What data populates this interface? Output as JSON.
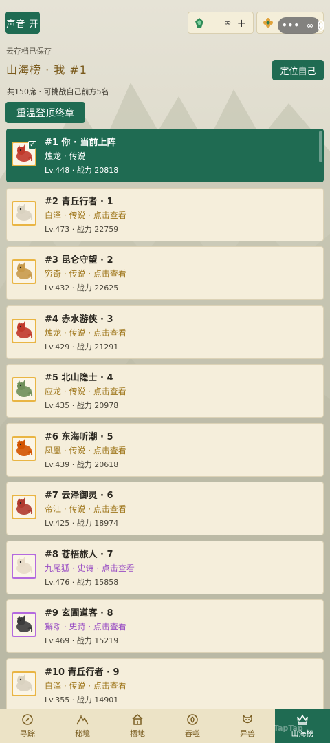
{
  "topbar": {
    "sound_label": "声音 开",
    "resource_a": {
      "icon": "jade-icon",
      "value": "∞",
      "plus": "+"
    },
    "resource_b": {
      "icon": "flower-icon",
      "value": "∞"
    },
    "capsule_dots": "•••"
  },
  "header": {
    "save_note": "云存档已保存",
    "rank_title": "山海榜 · 我 #1",
    "locate_label": "定位自己",
    "seat_info": "共150席 · 可挑战自己前方5名",
    "replay_label": "重温登顶终章"
  },
  "rankings": [
    {
      "line1": "#1  你 · 当前上阵",
      "line2": "烛龙 · 传说",
      "line3": "Lv.448 · 战力 20818",
      "me": true,
      "rarity": "legend",
      "creature": "dragon-icon",
      "color": "#c0392b"
    },
    {
      "line1": "#2  青丘行者 · 1",
      "line2": "白泽 · 传说 · 点击查看",
      "line3": "Lv.473 · 战力 22759",
      "rarity": "legend",
      "creature": "baize-icon",
      "color": "#d9d2c0"
    },
    {
      "line1": "#3  昆仑守望 · 2",
      "line2": "穷奇 · 传说 · 点击查看",
      "line3": "Lv.432 · 战力 22625",
      "rarity": "legend",
      "creature": "qiongqi-icon",
      "color": "#c89a4a"
    },
    {
      "line1": "#4  赤水游侠 · 3",
      "line2": "烛龙 · 传说 · 点击查看",
      "line3": "Lv.429 · 战力 21291",
      "rarity": "legend",
      "creature": "dragon-icon",
      "color": "#c0392b"
    },
    {
      "line1": "#5  北山隐士 · 4",
      "line2": "应龙 · 传说 · 点击查看",
      "line3": "Lv.435 · 战力 20978",
      "rarity": "legend",
      "creature": "yinglong-icon",
      "color": "#6f8f5a"
    },
    {
      "line1": "#6  东海听潮 · 5",
      "line2": "凤凰 · 传说 · 点击查看",
      "line3": "Lv.439 · 战力 20618",
      "rarity": "legend",
      "creature": "phoenix-icon",
      "color": "#d35400"
    },
    {
      "line1": "#7  云泽御灵 · 6",
      "line2": "帝江 · 传说 · 点击查看",
      "line3": "Lv.425 · 战力 18974",
      "rarity": "legend",
      "creature": "dijiang-icon",
      "color": "#b03a2e"
    },
    {
      "line1": "#8  苍梧旅人 · 7",
      "line2": "九尾狐 · 史诗 · 点击查看",
      "line3": "Lv.476 · 战力 15858",
      "rarity": "epic",
      "creature": "ninetail-fox-icon",
      "color": "#e8dcc8"
    },
    {
      "line1": "#9  玄圃道客 · 8",
      "line2": "獬豸 · 史诗 · 点击查看",
      "line3": "Lv.469 · 战力 15219",
      "rarity": "epic",
      "creature": "xiezhi-icon",
      "color": "#3b3b3b"
    },
    {
      "line1": "#10  青丘行者 · 9",
      "line2": "白泽 · 传说 · 点击查看",
      "line3": "Lv.355 · 战力 14901",
      "rarity": "legend",
      "creature": "baize-icon",
      "color": "#d9d2c0"
    }
  ],
  "nav": [
    {
      "label": "寻踪",
      "icon": "compass-icon"
    },
    {
      "label": "秘境",
      "icon": "mountain-icon"
    },
    {
      "label": "栖地",
      "icon": "house-icon"
    },
    {
      "label": "吞噬",
      "icon": "swirl-icon"
    },
    {
      "label": "异兽",
      "icon": "beast-mask-icon"
    },
    {
      "label": "山海榜",
      "icon": "crown-icon",
      "active": true
    }
  ],
  "watermark": "TapTap"
}
